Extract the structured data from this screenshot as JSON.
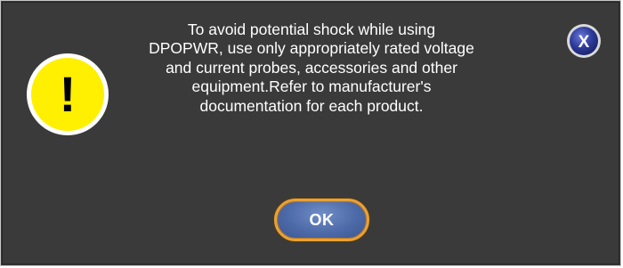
{
  "dialog": {
    "message": "To avoid potential shock while using\nDPOPWR, use only appropriately rated voltage\nand current probes, accessories and other\nequipment.Refer to manufacturer's\ndocumentation for each product.",
    "ok_label": "OK",
    "close_glyph": "X",
    "warning_glyph": "!",
    "icons": {
      "warning": "warning-icon",
      "close": "close-icon"
    }
  },
  "colors": {
    "background": "#3a3a3a",
    "text": "#ffffff",
    "warning_fill": "#ffef00",
    "ok_button_fill": "#4d6aa8",
    "ok_button_border": "#e8a233",
    "close_button_fill": "#2d3b9a"
  }
}
